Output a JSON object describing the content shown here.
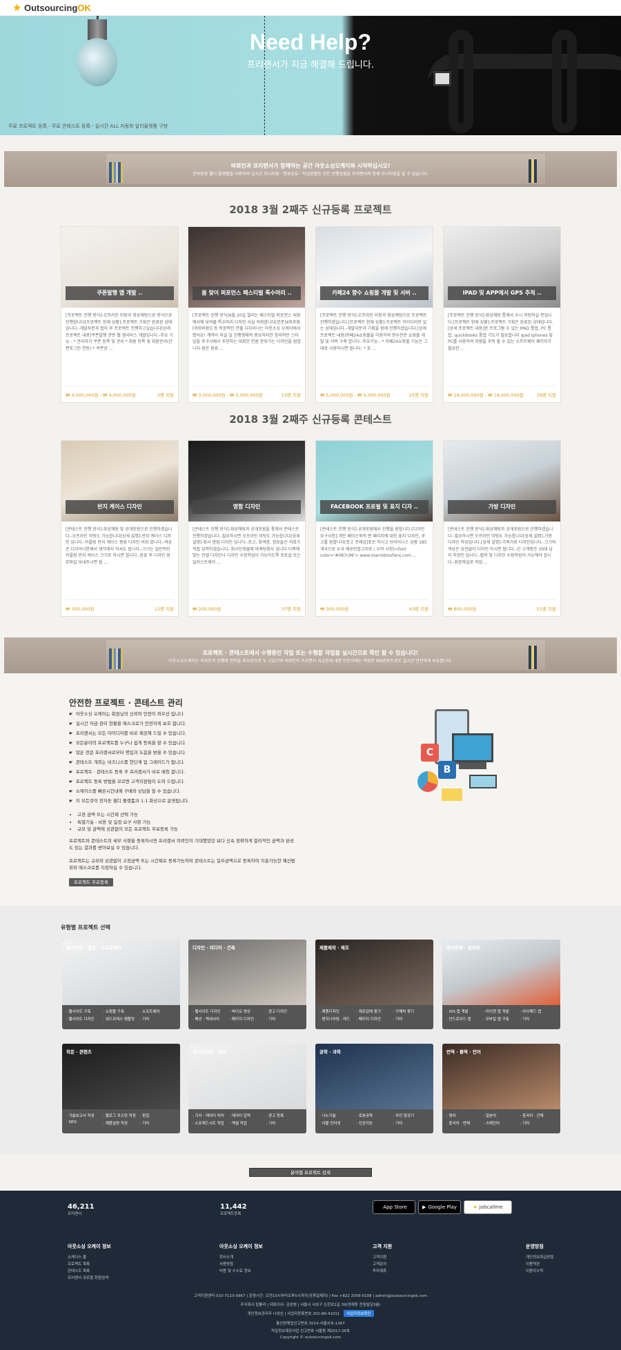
{
  "header": {
    "logo_main": "Outsourcing",
    "logo_accent": "OK"
  },
  "hero": {
    "title": "Need Help?",
    "subtitle": "프리랜서가 지금 해결해 드립니다.",
    "note": "무료 프로젝트 등록 - 무료 콘테스트 등록 - 실시간 ALL 자동화 알리올렛폼 구현"
  },
  "banner1": {
    "title": "의뢰인과 프리랜서가 함께하는 공간 아웃소싱오케이와 시작하십시오!",
    "sub": "전자동화 웹디 플랫폼을 사용하여 실시간 모니터링 · 정보공유 · 작금현황등 모든 진행상황을 프리랜서와 함께 모니터링을 할 수 있습니다."
  },
  "projects": {
    "heading": "2018 3월 2째주 신규등록 프로젝트",
    "items": [
      {
        "title": "쿠폰발행 앱 개발 ..",
        "desc": "[프로젝트 진행 방식]-오프라인 미팅과 화상채팅으로 방식으로 진행합니다[프로젝트 현재 상황]-프로젝트 기획은 완료된 상태입니다.-개발자분과 협의 후 프로젝트 진행하고싶습니다[상세 프로젝트 내용]쿠폰발행 관련 웹 앱서비스 개발입니다.-주요 기능 - * 관리자가 쿠폰 등록 및 관리 * 회원 등록 및 회원관리(간편로그인 연동) * 쿠폰상 ...",
        "price": "₩ 4,000,000원 - ₩ 4,000,000원",
        "bids": "3명 지원"
      },
      {
        "title": "봄 맞이 퍼포먼스 페스티벌 특수머리 ..",
        "desc": "[프로젝트 진행 방식]4월 20일 열리는 페스티벌 퍼포먼스 대회에서에 보여줄 특수머리 디자인 사실 의뢰합니다[본문]4와포럼[의뢰비용]) 등 독창적인 연출 디자이너는 아웃소싱 오케이에서 봤어요! 계약이 되실 일 진행형태적 중요하지만 창의적인 스타일을 추구시에서 추천하는 대회인 만큼 분위기는 디자인을 원합니다-원본 원료 ...",
        "price": "₩ 3,000,000원 - ₩ 5,000,000원",
        "bids": "13명 지원"
      },
      {
        "title": "카페24 향수 쇼핑몰 개발 및 서버 ..",
        "desc": "[프로젝트 진행 방식]-오프라인 미팅과 화상채팅으로 프로젝트 진행하겠습니다.[프로젝트 현재 상황]-프로젝트 아이디어만 있는 상태입니다.-개발자분과 기획을 함께 진행하겠습니다.[상세 프로젝트 내용]카페24쇼핑몰을 이용하여 향수전문 쇼핑몰 개발 및 서버 구축 합니다.-주요기능 - * 카페24쇼핑몰 기능은 그대로 사용하시면 됩니다. * 포 ...",
        "price": "₩ 5,000,000원 - ₩ 5,000,000원",
        "bids": "25명 지원"
      },
      {
        "title": "IPAD 및 APP에서 GPS 추적 ..",
        "desc": "[프로젝트 진행 방식]-화상채팅 통해서 수시 미팅하실 분입니다.[프로젝트 현재 상황]-프로젝트 기획은 완료된 상태입니다.[상세 프로젝트 내용]현 프로그램 수 있는 IPAD 통합, PC 통합, quickbooks 통합 기도가 필요합니다 Ipad Iphones 및 PC를 사용하여 차량을 추적 할 수 있는 소프트웨어 패키지가 필요한 ...",
        "price": "₩ 18,000,000원 - ₩ 18,000,000원",
        "bids": "39명 지원"
      }
    ]
  },
  "contests": {
    "heading": "2018 3월 2째주 신규등록 콘테스트",
    "items": [
      {
        "title": "반지 케이스 디자인",
        "desc": "[콘테스트 진행 방식]-화상채팅 및 공개포럼으로 진행하겠습니다.-오프라인 미팅도 가능합니다[상세 설명]-반지 케이스 디자인 입니다.-커플링 반지 케이스 종류 디자인 의뢰 합니다.-색상은 디자이너분께서 생각에서 하셔도 됩니다.-크기는 일반적인 커플링 반지 케이스 크기로 하시면 됩니다.-완료 후 디자인 원본파일 보내주시면 됩 ...",
        "price": "₩ 300,000원",
        "bids": "12명 지원"
      },
      {
        "title": "명함 디자인",
        "desc": "[콘테스트 진행 방식]-화상채팅과 공개포럼을 통해서 콘테스트 진행하겠습니다.-필요하시면 오프라인 미팅도 가능합니다[상세 설명]-회사 명함 디자인 입니다.-로고, 회색명, 정보들은 저희가 직접 입력하겠습니다.-회사인생물에 마케팅회사 입니다 디렉에 맞는 컨셉 디자인나 디자인 수정작업이 가능하도록 포토샵 또는 일러스트레이 ...",
        "price": "₩ 200,000원",
        "bids": "37명 지원"
      },
      {
        "title": "FACEBOOK 프로필 및 표지 디자 ..",
        "desc": "[콘테스트 진행 방식]-공개포럼에서 진행을 원합니다.[디자인 요구사항]:개인 페이스북의 변 페이지에 대한 표지 디자인, 로고를 원합니다[로고 프레임]포르 하시고 브라이니스 상품 185 개국으로 우국 배송빈합고지로 / 우의 사항]<font color='#087c99'> www.marrobrosfans.com ...",
        "price": "₩ 300,000원",
        "bids": "43명 지원"
      },
      {
        "title": "가방 디자인",
        "desc": "[콘테스트 진행 방식]-화상채팅과 공개포럼으로 진행하겠습니다.-필요하시면 오프라인 미팅도 가능합니다[상세 설명]-가방 디자인 작업입니다.[상세 설명]-가죽가방 디자인입니다.-크기와 색상은 상관없이 디자인 하시면 됩니다.-간 고객층은 30대 남자 직장인 입니다.-캡쳐 및 디자인 수정작업이 가능해야 합니다.-원본파일로 작업 ...",
        "price": "₩ 600,000원",
        "bids": "51명 지원"
      }
    ]
  },
  "banner2": {
    "title": "프로젝트 · 콘테스트에서 수행중인 작업 또는 수행할 작업을 실시간으로 확인 할 수 있습니다!",
    "sub": "아웃소싱오케이는 의뢰인과 진행에 안전을 최우선으로 두 고있으며 의뢰인이 프리랜서 지금현재 대한 안전거래는 적정안 RM관포트로도 실시간 안전하게 보호됩니다."
  },
  "safe": {
    "title": "안전한 프로젝트 · 콘테스트 관리",
    "list": [
      "아웃소싱 오케이는 회원님의 신뢰와 안전이 최우선 입니다",
      "실시간 자금 관리 현황을 에스크로가 안전하게 보호 합니다.",
      "프리랜서는 모든 아이디어를 바로 제공해 드릴 수 있습니다.",
      "모든분야의 프로젝트를 누구나 쉽게 등록을 할 수 있습니다.",
      "많은 전문 프리랜서로부터 명입과 도움을 받을 수 있습니다.",
      "콘테스트 개최는 비즈니스를 한단계 업 그레이드가 됩니다.",
      "프로젝트 · 콘테스트 등록 후 프리랜서가 바로 매칭 합니다.",
      "프로젝트 등록 방법을 모르면 고객지원팀이 도와 드립니다.",
      "쇼케이스를 빠른시간내에 구매와 상담을 할 수 있습니다.",
      "이 모든것이 전자동 웹디 플랫폼과 1:1 화상으로 운영됩니다."
    ],
    "bullets": [
      "고정 금액 또는 시간제 선택 가능",
      "특별기술 - 비용 및 일정 요구 사항 가능",
      "규모 및 금액에 상관없이 모든 프로젝트 무료등록 가능"
    ],
    "p1": "프로젝트와 콘테스트의 세부 사항을 등록하시면 프리랜서 의뢰인이 기대했었던 보다 신속 정확하게 합리적인 금액과 완성도 있는 결과를 받아보실 수 있습니다.",
    "p2": "프로젝트는 규모와 상관없이 고정금액 또는 시간제로 등록가능하며 콘테스트는 일부금액으로 등록하여 지출가능한 예산범위와 에스크로를 지정하실 수 있습니다.",
    "button": "프로젝트 무료등록"
  },
  "categories": {
    "title": "유형별 프로젝트 선택",
    "items": [
      {
        "label": "웹사이트 · 웹앱 · 소프트웨어",
        "links": [
          "웹사이트 구축",
          "쇼핑몰 구축",
          "소프트웨어",
          "웹사이트 디자인",
          "워드프레스 템플릿",
          "기타"
        ]
      },
      {
        "label": "디자인 · 미디어 · 건축",
        "links": [
          "웹사이트 디자인",
          "비디오 영상",
          "광고 디자인",
          "패션 · 액세서리",
          "패키지 디자인",
          "기타"
        ]
      },
      {
        "label": "제품제작 · 제조",
        "links": [
          "제품디자인",
          "제조업체 찾기",
          "구매처 찾기",
          "엔지니어링 · 케드",
          "패키지 디자인",
          "기타"
        ]
      },
      {
        "label": "휴대전화 · 컴퓨팅",
        "links": [
          "iOS 앱 개발",
          "타이젠 앱 개발",
          "아이패드 앱",
          "안드로이드 앱",
          "모바일 앱 구축",
          "기타"
        ]
      },
      {
        "label": "작문 · 콘텐츠",
        "links": [
          "기술보고서 작성",
          "블로그 포스팅 작성",
          "편집",
          "SEO",
          "제품설명 작성",
          "기타"
        ]
      },
      {
        "label": "데이터입력 · 관리",
        "links": [
          "기사 · 데이터 처리",
          "데이터 입력",
          "광고 등록",
          "스프레드시트 작업",
          "엑셀 작업",
          "기타"
        ]
      },
      {
        "label": "공학 · 과학",
        "links": [
          "나노기술",
          "로봇공학",
          "무인 항공기",
          "사물 인터넷",
          "인공지능",
          "기타"
        ]
      },
      {
        "label": "번역 · 통역 · 언어",
        "links": [
          "영어",
          "일본어",
          "중국어 · 간체",
          "중국어 · 번체",
          "스페인어",
          "기타"
        ]
      }
    ],
    "search_button": "분야별 프로젝트 검색"
  },
  "footer": {
    "stats": [
      {
        "value": "46,211",
        "label": "프리랜서"
      },
      {
        "value": "11,442",
        "label": "프로젝트등록"
      }
    ],
    "stores": [
      "App Store",
      "Google Play",
      "jobcallme"
    ],
    "cols": [
      {
        "heading": "아웃소싱 오케이 정보",
        "links": [
          "쇼케이스 몰",
          "프로젝트 목록",
          "콘테스트 목록",
          "프리랜서 공로할 회원검색"
        ]
      },
      {
        "heading": "아웃소싱 오케이 정보",
        "links": [
          "회사소개",
          "사용방법",
          "비용 및 수수료 정보"
        ]
      },
      {
        "heading": "고객 지원",
        "links": [
          "고객지원",
          "고객문의",
          "투자제휴"
        ]
      },
      {
        "heading": "운영방침",
        "links": [
          "개인정보취급방침",
          "이용약관",
          "이용자수칙"
        ]
      }
    ],
    "line1": "고객지원센터 010-7110-0967 | 운영시간: 오전10시부터오후5시까지(공휴일제외) | Fax +822 2058-0108 | admin@outsourcingok.com",
    "line2": "주식회사 칼롤리 | 대표이사: 김성영 | 서울시 서초구 논현로2길 39(양재동 전림빌딩3층)",
    "line3": "개인정보관리자 나성신 | 사업자등록번호 201-86-41011",
    "line3_badge": "사업자정보확인",
    "line4": "통신판매업신고번호 2014-서울서초-1367",
    "line5": "직업정보제공사업 신고번호 서울동 제2017-26호",
    "line6": "Copyright © outsourcingok.com"
  }
}
